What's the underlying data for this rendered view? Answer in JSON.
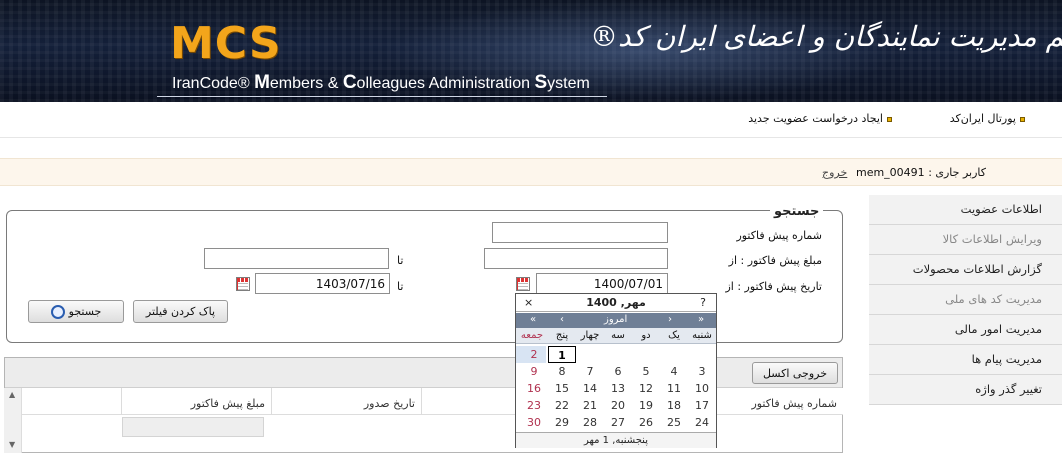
{
  "banner": {
    "logo": "MCS",
    "subtitle_pre": "IranCode® ",
    "subtitle_parts": [
      "M",
      "embers & ",
      "C",
      "olleagues Administration ",
      "S",
      "ystem"
    ],
    "persian_title": "سیستم مدیریت نمایندگان و اعضای ایران کد®"
  },
  "topnav": {
    "portal": "پورتال ایران‌کد",
    "new_membership": "ایجاد درخواست عضویت جدید"
  },
  "userbar": {
    "user_label": "کاربر جاری :",
    "username": "mem_00491",
    "logout": "خروج"
  },
  "menu": {
    "items": [
      {
        "label": "اطلاعات عضویت",
        "dim": false
      },
      {
        "label": "ویرایش اطلاعات کالا",
        "dim": true
      },
      {
        "label": "گزارش اطلاعات محصولات",
        "dim": false
      },
      {
        "label": "مدیریت کد های ملی",
        "dim": true
      },
      {
        "label": "مدیریت امور مالی",
        "dim": false
      },
      {
        "label": "مدیریت پیام ها",
        "dim": false
      },
      {
        "label": "تغییر گذر واژه",
        "dim": false
      }
    ]
  },
  "search": {
    "legend": "جستجو",
    "invoice_number_label": "شماره پیش فاکتور",
    "invoice_number_value": "",
    "amount_from_label": "مبلغ پیش فاکتور : از",
    "amount_from_value": "",
    "amount_to_label": "تا",
    "amount_to_value": "",
    "date_from_label": "تاریخ پیش فاکتور : از",
    "date_from_value": "1400/07/01",
    "date_to_label": "تا",
    "date_to_value": "1403/07/16",
    "clear_filter": "پاک کردن فیلتر",
    "search_button": "جستجو"
  },
  "results": {
    "excel_button": "خروجی اکسل",
    "columns": [
      "شماره پیش فاکتور",
      "تاریخ صدور",
      "مبلغ پیش فاکتور"
    ]
  },
  "calendar": {
    "title": "مهر, 1400",
    "close": "×",
    "help": "?",
    "nav": {
      "prev_year": "«",
      "prev_month": "‹",
      "today": "امروز",
      "next_month": "›",
      "next_year": "»"
    },
    "day_names": [
      "شنبه",
      "یک",
      "دو",
      "سه",
      "چهار",
      "پنج",
      "جمعه"
    ],
    "weeks": [
      [
        "",
        "",
        "",
        "",
        "",
        "1",
        "2"
      ],
      [
        "3",
        "4",
        "5",
        "6",
        "7",
        "8",
        "9"
      ],
      [
        "10",
        "11",
        "12",
        "13",
        "14",
        "15",
        "16"
      ],
      [
        "17",
        "18",
        "19",
        "20",
        "21",
        "22",
        "23"
      ],
      [
        "24",
        "25",
        "26",
        "27",
        "28",
        "29",
        "30"
      ]
    ],
    "selected_day": "1",
    "footer": "پنجشنبه, 1 مهر"
  }
}
